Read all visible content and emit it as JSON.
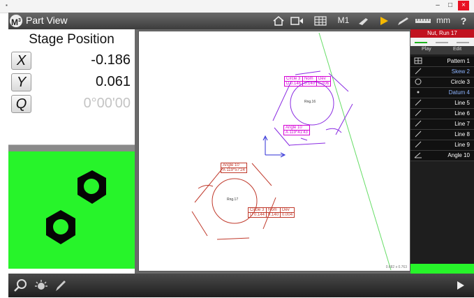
{
  "window": {
    "app_icon": "m3-icon",
    "minimize": "–",
    "maximize": "□",
    "close": "×"
  },
  "toolbar": {
    "logo_letter": "M",
    "logo_sup": "3",
    "title": "Part View",
    "m1_label": "M1",
    "units_label": "mm",
    "help_label": "?"
  },
  "stage": {
    "title": "Stage Position",
    "x_label": "X",
    "x_value": "-0.186",
    "y_label": "Y",
    "y_value": "0.061",
    "q_label": "Q",
    "q_value": "0°00'00"
  },
  "run": {
    "title": "Nut, Run 17",
    "play_label": "Play",
    "edit_label": "Edit"
  },
  "features": [
    {
      "icon": "pattern-icon",
      "label": "Pattern 1",
      "color": "#ffffff"
    },
    {
      "icon": "line-icon",
      "label": "Skew 2",
      "color": "#8db4ff"
    },
    {
      "icon": "circle-icon",
      "label": "Circle 3",
      "color": "#ffffff"
    },
    {
      "icon": "point-icon",
      "label": "Datum 4",
      "color": "#8db4ff"
    },
    {
      "icon": "line-icon",
      "label": "Line 5",
      "color": "#ffffff"
    },
    {
      "icon": "line-icon",
      "label": "Line 6",
      "color": "#ffffff"
    },
    {
      "icon": "line-icon",
      "label": "Line 7",
      "color": "#ffffff"
    },
    {
      "icon": "line-icon",
      "label": "Line 8",
      "color": "#ffffff"
    },
    {
      "icon": "line-icon",
      "label": "Line 9",
      "color": "#ffffff"
    },
    {
      "icon": "angle-icon",
      "label": "Angle 10",
      "color": "#ffffff"
    }
  ],
  "canvas": {
    "zoom_readout": "0.682 x 0.763",
    "top_part": {
      "center_label": "Rng.16",
      "table_headers": [
        "Circle 3",
        "Nom",
        "Dev"
      ],
      "table_values": [
        "D 0.146",
        "0.140",
        "0.006"
      ],
      "angle_title": "Angle 10",
      "angle_value": "A 119°41'43"
    },
    "bottom_part": {
      "center_label": "Rng.17",
      "table_headers": [
        "Circle 3",
        "Nom",
        "Dev"
      ],
      "table_values": [
        "D 0.144",
        "0.140",
        "0.004"
      ],
      "angle_title": "Angle 10",
      "angle_value": "A 119°57'24"
    }
  },
  "colors": {
    "video_green": "#27f42a",
    "run_red": "#c1121f",
    "top_part_purple": "#8a2be2",
    "bottom_part_red": "#c0392b",
    "label_magenta": "#d400d4"
  }
}
